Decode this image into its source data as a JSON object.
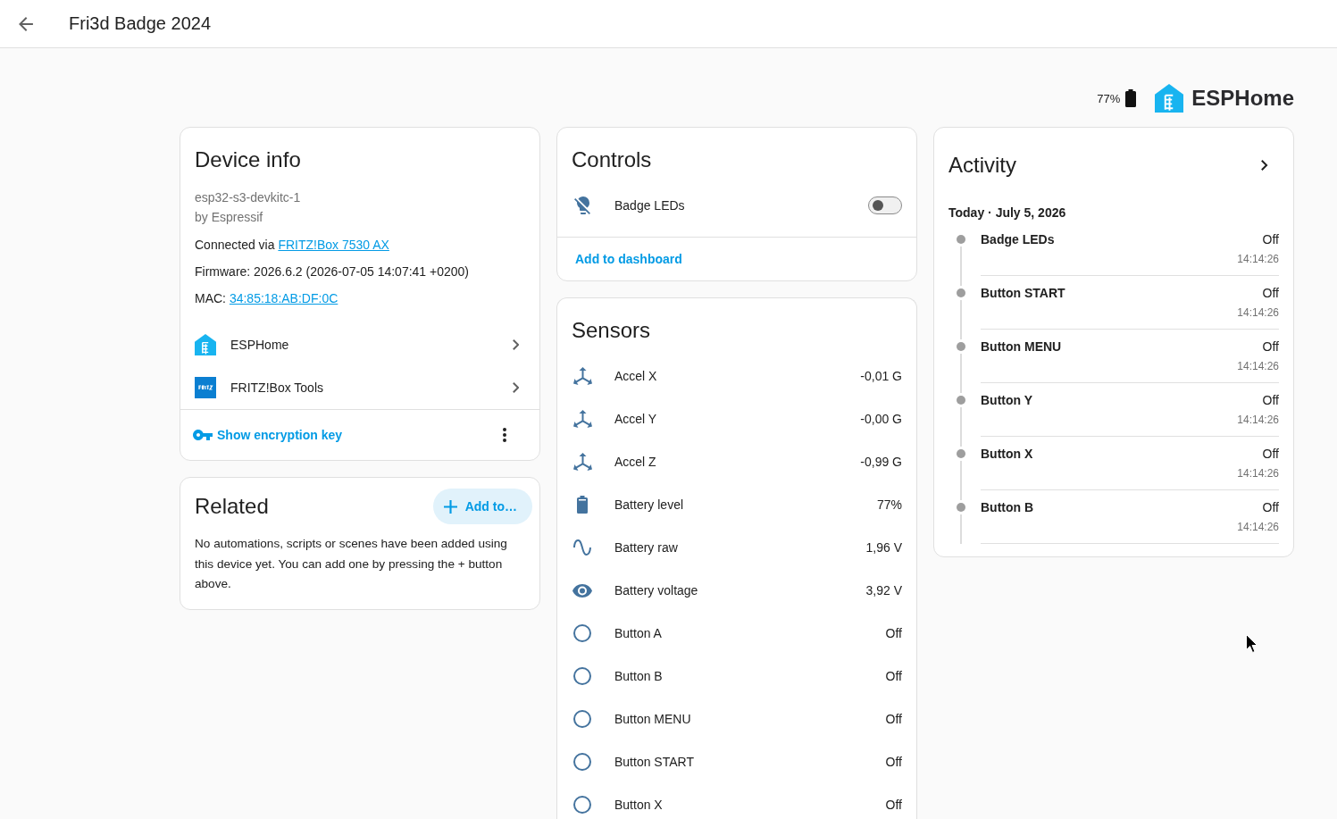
{
  "top_bar": {
    "title": "Fri3d Badge 2024"
  },
  "header": {
    "battery_reading": "77%",
    "brand": "ESPHome"
  },
  "device_info": {
    "title": "Device info",
    "model": "esp32-s3-devkitc-1",
    "manufacturer": "by Espressif",
    "connection": {
      "label": "Connected via",
      "link": "FRITZ!Box 7530 AX"
    },
    "firmware": "Firmware: 2026.6.2 (2026-07-05 14:07:41 +0200)",
    "mac": {
      "label": "MAC:",
      "link": "34:85:18:AB:DF:0C"
    },
    "integrations": [
      {
        "kind": "esphome",
        "name": "ESPHome"
      },
      {
        "kind": "fritz",
        "name": "FRITZ!Box Tools"
      }
    ],
    "action": "Show encryption key"
  },
  "related": {
    "title": "Related",
    "button": "Add to…",
    "text": "No automations, scripts or scenes have been added using this device yet. You can add one by pressing the + button above."
  },
  "controls": {
    "title": "Controls",
    "items": [
      {
        "name": "Badge LEDs",
        "on": false
      }
    ],
    "action": "Add to dashboard"
  },
  "sensors": {
    "title": "Sensors",
    "items": [
      {
        "kind": "axis",
        "name": "Accel X",
        "value": "-0,01 G"
      },
      {
        "kind": "axis",
        "name": "Accel Y",
        "value": "-0,00 G"
      },
      {
        "kind": "axis",
        "name": "Accel Z",
        "value": "-0,99 G"
      },
      {
        "kind": "battery",
        "name": "Battery level",
        "value": "77%"
      },
      {
        "kind": "wave",
        "name": "Battery raw",
        "value": "1,96 V"
      },
      {
        "kind": "eye",
        "name": "Battery voltage",
        "value": "3,92 V"
      },
      {
        "kind": "binary",
        "name": "Button A",
        "value": "Off"
      },
      {
        "kind": "binary",
        "name": "Button B",
        "value": "Off"
      },
      {
        "kind": "binary",
        "name": "Button MENU",
        "value": "Off"
      },
      {
        "kind": "binary",
        "name": "Button START",
        "value": "Off"
      },
      {
        "kind": "binary",
        "name": "Button X",
        "value": "Off"
      }
    ]
  },
  "activity": {
    "title": "Activity",
    "date": "Today · July 5, 2026",
    "entries": [
      {
        "name": "Badge LEDs",
        "state": "Off",
        "time": "14:14:26"
      },
      {
        "name": "Button START",
        "state": "Off",
        "time": "14:14:26"
      },
      {
        "name": "Button MENU",
        "state": "Off",
        "time": "14:14:26"
      },
      {
        "name": "Button Y",
        "state": "Off",
        "time": "14:14:26"
      },
      {
        "name": "Button X",
        "state": "Off",
        "time": "14:14:26"
      },
      {
        "name": "Button B",
        "state": "Off",
        "time": "14:14:26"
      }
    ]
  }
}
